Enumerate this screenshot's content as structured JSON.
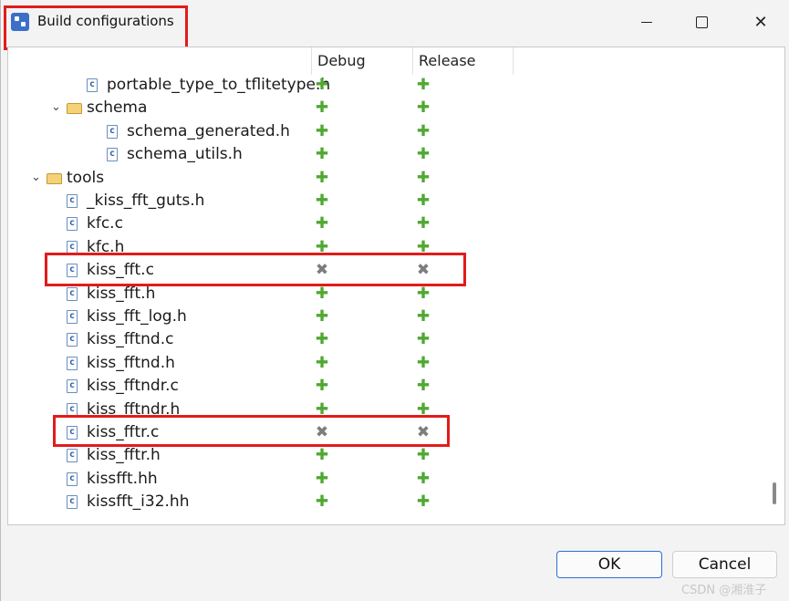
{
  "window": {
    "title": "Build configurations",
    "minimize_icon": "minimize-icon",
    "maximize_icon": "maximize-icon",
    "close_glyph": "✕",
    "app_icon": "eclipse-app-icon"
  },
  "columns": {
    "debug": "Debug",
    "release": "Release"
  },
  "rows": [
    {
      "label": "portable_type_to_tflitetype.h",
      "kind": "file",
      "debug": "include",
      "release": "include"
    },
    {
      "label": "schema",
      "kind": "folder",
      "expanded": true,
      "debug": "include",
      "release": "include"
    },
    {
      "label": "schema_generated.h",
      "kind": "file",
      "debug": "include",
      "release": "include"
    },
    {
      "label": "schema_utils.h",
      "kind": "file",
      "debug": "include",
      "release": "include"
    },
    {
      "label": "tools",
      "kind": "folder",
      "expanded": true,
      "debug": "include",
      "release": "include"
    },
    {
      "label": "_kiss_fft_guts.h",
      "kind": "file",
      "debug": "include",
      "release": "include"
    },
    {
      "label": "kfc.c",
      "kind": "file",
      "debug": "include",
      "release": "include"
    },
    {
      "label": "kfc.h",
      "kind": "file",
      "debug": "include",
      "release": "include"
    },
    {
      "label": "kiss_fft.c",
      "kind": "file",
      "debug": "exclude",
      "release": "exclude"
    },
    {
      "label": "kiss_fft.h",
      "kind": "file",
      "debug": "include",
      "release": "include"
    },
    {
      "label": "kiss_fft_log.h",
      "kind": "file",
      "debug": "include",
      "release": "include"
    },
    {
      "label": "kiss_fftnd.c",
      "kind": "file",
      "debug": "include",
      "release": "include"
    },
    {
      "label": "kiss_fftnd.h",
      "kind": "file",
      "debug": "include",
      "release": "include"
    },
    {
      "label": "kiss_fftndr.c",
      "kind": "file",
      "debug": "include",
      "release": "include"
    },
    {
      "label": "kiss_fftndr.h",
      "kind": "file",
      "debug": "include",
      "release": "include"
    },
    {
      "label": "kiss_fftr.c",
      "kind": "file",
      "debug": "exclude",
      "release": "exclude"
    },
    {
      "label": "kiss_fftr.h",
      "kind": "file",
      "debug": "include",
      "release": "include"
    },
    {
      "label": "kissfft.hh",
      "kind": "file",
      "debug": "include",
      "release": "include"
    },
    {
      "label": "kissfft_i32.hh",
      "kind": "file",
      "debug": "include",
      "release": "include"
    }
  ],
  "buttons": {
    "ok": "OK",
    "cancel": "Cancel"
  },
  "watermark": "CSDN @湘淮子",
  "colors": {
    "highlight": "#e21b1b",
    "include": "#4fa832",
    "exclude": "#7d7d7d",
    "ok_border": "#2a6fd6"
  }
}
